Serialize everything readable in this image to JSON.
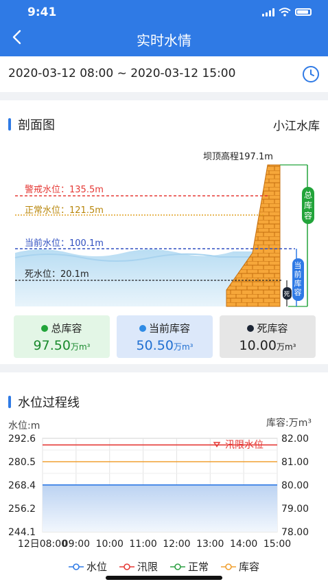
{
  "status_bar": {
    "time": "9:41"
  },
  "header": {
    "title": "实时水情"
  },
  "time_range": "2020-03-12 08:00 ~ 2020-03-12 15:00",
  "profile": {
    "title": "剖面图",
    "reservoir": "小江水库",
    "dam_crest": "坝顶高程197.1m",
    "levels": {
      "warning": "警戒水位：135.5m",
      "normal": "正常水位：121.5m",
      "current": "当前水位：100.1m",
      "dead": "死水位：20.1m"
    },
    "markers": {
      "total": "总库容",
      "current": "当前库容",
      "dead": "死"
    },
    "stats": [
      {
        "label": "总库容",
        "value": "97.50",
        "unit": "万m³",
        "dot": "#22a43a",
        "bg": "#e3f6e6",
        "color": "#1a8a2e"
      },
      {
        "label": "当前库容",
        "value": "50.50",
        "unit": "万m³",
        "dot": "#2f8be5",
        "bg": "#dce8fa",
        "color": "#1f6fd1"
      },
      {
        "label": "死库容",
        "value": "10.00",
        "unit": "万m³",
        "dot": "#1c2535",
        "bg": "#e6e6e6",
        "color": "#222222"
      }
    ]
  },
  "process": {
    "title": "水位过程线",
    "left_axis_title": "水位:m",
    "right_axis_title": "库容:万m³",
    "flood_label": "汛限水位"
  },
  "chart_data": {
    "type": "line",
    "categories": [
      "12日08:00",
      "09:00",
      "10:00",
      "11:00",
      "12:00",
      "13:00",
      "14:00",
      "15:00"
    ],
    "left_axis": {
      "ticks": [
        "292.6",
        "280.5",
        "268.4",
        "256.2",
        "244.1"
      ],
      "ylim": [
        244.1,
        292.6
      ]
    },
    "right_axis": {
      "ticks": [
        "82.00",
        "81.00",
        "80.00",
        "79.00",
        "78.00"
      ],
      "ylim": [
        78.0,
        82.0
      ]
    },
    "series": [
      {
        "name": "水位",
        "color": "#2f7ae5",
        "values": [
          268.4,
          268.4,
          268.4,
          268.4,
          268.4,
          268.4,
          268.4,
          268.4
        ]
      },
      {
        "name": "汛限",
        "color": "#e53935",
        "values": [
          289.2,
          289.2,
          289.2,
          289.2,
          289.2,
          289.2,
          289.2,
          289.2
        ]
      },
      {
        "name": "正常",
        "color": "#2ea043",
        "values": []
      },
      {
        "name": "库容",
        "color": "#f0a030",
        "values": [
          81.0,
          81.0,
          81.0,
          81.0,
          81.0,
          81.0,
          81.0,
          81.0
        ]
      }
    ],
    "grid": true,
    "legend_position": "bottom"
  }
}
